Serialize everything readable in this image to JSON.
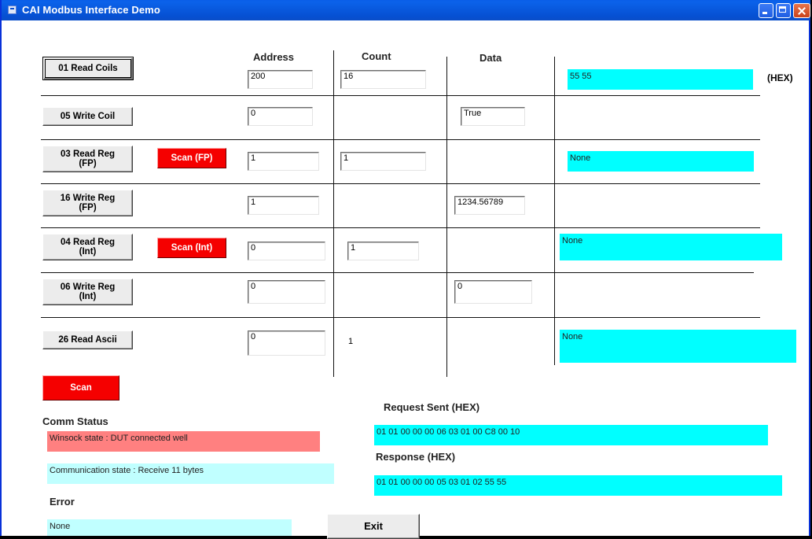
{
  "window": {
    "title": "CAI Modbus Interface Demo"
  },
  "headers": {
    "address": "Address",
    "count": "Count",
    "data": "Data"
  },
  "rows": [
    {
      "button": "01 Read Coils",
      "address": "200",
      "count": "16",
      "result": "55 55",
      "result_unit": "(HEX)"
    },
    {
      "button": "05 Write Coil",
      "address": "0",
      "data": "True"
    },
    {
      "button": "03 Read Reg\n(FP)",
      "scan": "Scan (FP)",
      "address": "1",
      "count": "1",
      "result": "None"
    },
    {
      "button": "16 Write Reg\n(FP)",
      "address": "1",
      "data": "1234.56789"
    },
    {
      "button": "04 Read Reg\n(Int)",
      "scan": "Scan (Int)",
      "address": "0",
      "count": "1",
      "result": "None"
    },
    {
      "button": "06 Write Reg\n(Int)",
      "address": "0",
      "data": "0"
    },
    {
      "button": "26 Read Ascii",
      "address": "0",
      "count": "1",
      "result": "None"
    }
  ],
  "scan_button": "Scan",
  "comm_status": {
    "heading": "Comm Status",
    "winsock": "Winsock state :  DUT connected well",
    "communication": "Communication state :  Receive 11 bytes"
  },
  "error": {
    "heading": "Error",
    "value": "None"
  },
  "request": {
    "heading": "Request Sent (HEX)",
    "value": "01 01 00 00 00 06 03 01 00 C8 00 10"
  },
  "response": {
    "heading": "Response (HEX)",
    "value": "01 01 00 00 00 05 03 01 02 55 55"
  },
  "exit_button": "Exit",
  "colors": {
    "cyan": "#00ffff",
    "scan_red": "#f50000",
    "winsock_bg": "#ff8080",
    "comm_bg": "#c0ffff",
    "titlebar": "#0858dc"
  }
}
